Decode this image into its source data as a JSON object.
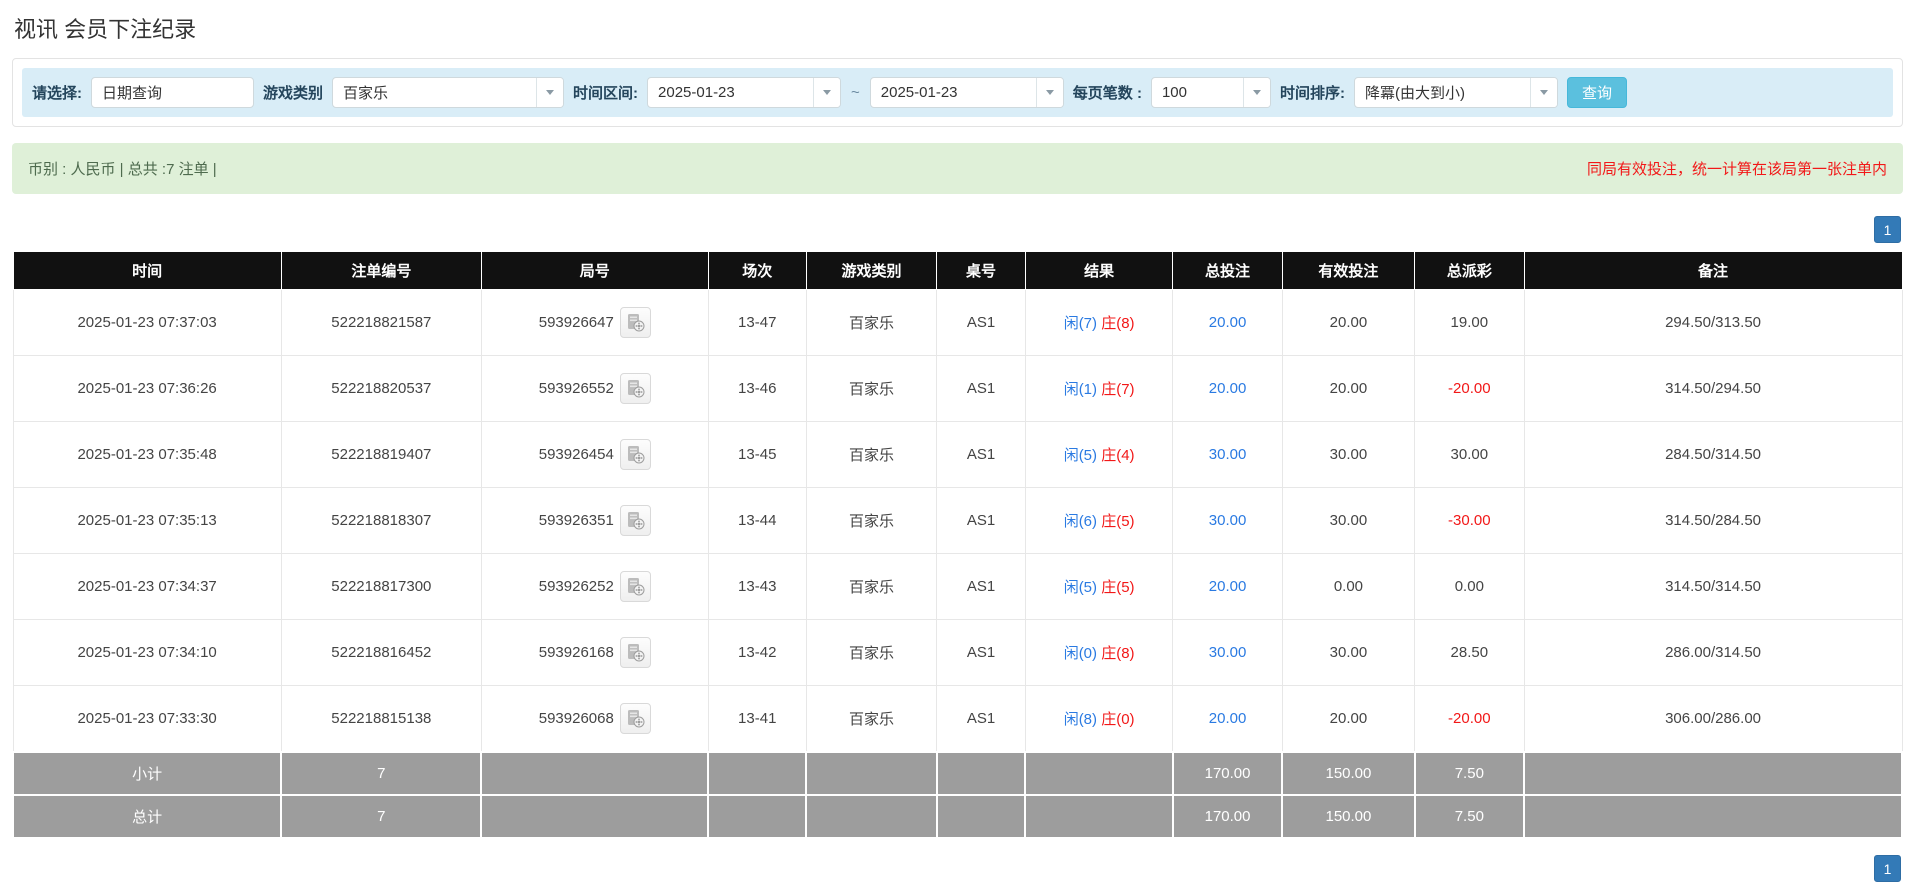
{
  "page": {
    "title": "视讯 会员下注纪录"
  },
  "filters": {
    "select_label": "请选择:",
    "select_value": "日期查询",
    "game_label": "游戏类别",
    "game_value": "百家乐",
    "range_label": "时间区间:",
    "date_from": "2025-01-23",
    "tilde": "~",
    "date_to": "2025-01-23",
    "page_size_label": "每页笔数 :",
    "page_size_value": "100",
    "sort_label": "时间排序:",
    "sort_value": "降冪(由大到小)",
    "search_button": "查询"
  },
  "notice": {
    "left": "币别 : 人民币 | 总共 :7 注单 |",
    "right": "同局有效投注，统一计算在该局第一张注单内"
  },
  "pagination": {
    "page": "1"
  },
  "table": {
    "headers": [
      "时间",
      "注单编号",
      "局号",
      "场次",
      "游戏类别",
      "桌号",
      "结果",
      "总投注",
      "有效投注",
      "总派彩",
      "备注"
    ],
    "rows": [
      {
        "time": "2025-01-23 07:37:03",
        "bet_id": "522218821587",
        "round_id": "593926647",
        "session": "13-47",
        "game": "百家乐",
        "table_no": "AS1",
        "result_player": "闲(7)",
        "result_banker": "庄(8)",
        "total_bet": "20.00",
        "valid_bet": "20.00",
        "payout": "19.00",
        "note": "294.50/313.50"
      },
      {
        "time": "2025-01-23 07:36:26",
        "bet_id": "522218820537",
        "round_id": "593926552",
        "session": "13-46",
        "game": "百家乐",
        "table_no": "AS1",
        "result_player": "闲(1)",
        "result_banker": "庄(7)",
        "total_bet": "20.00",
        "valid_bet": "20.00",
        "payout": "-20.00",
        "note": "314.50/294.50"
      },
      {
        "time": "2025-01-23 07:35:48",
        "bet_id": "522218819407",
        "round_id": "593926454",
        "session": "13-45",
        "game": "百家乐",
        "table_no": "AS1",
        "result_player": "闲(5)",
        "result_banker": "庄(4)",
        "total_bet": "30.00",
        "valid_bet": "30.00",
        "payout": "30.00",
        "note": "284.50/314.50"
      },
      {
        "time": "2025-01-23 07:35:13",
        "bet_id": "522218818307",
        "round_id": "593926351",
        "session": "13-44",
        "game": "百家乐",
        "table_no": "AS1",
        "result_player": "闲(6)",
        "result_banker": "庄(5)",
        "total_bet": "30.00",
        "valid_bet": "30.00",
        "payout": "-30.00",
        "note": "314.50/284.50"
      },
      {
        "time": "2025-01-23 07:34:37",
        "bet_id": "522218817300",
        "round_id": "593926252",
        "session": "13-43",
        "game": "百家乐",
        "table_no": "AS1",
        "result_player": "闲(5)",
        "result_banker": "庄(5)",
        "total_bet": "20.00",
        "valid_bet": "0.00",
        "payout": "0.00",
        "note": "314.50/314.50"
      },
      {
        "time": "2025-01-23 07:34:10",
        "bet_id": "522218816452",
        "round_id": "593926168",
        "session": "13-42",
        "game": "百家乐",
        "table_no": "AS1",
        "result_player": "闲(0)",
        "result_banker": "庄(8)",
        "total_bet": "30.00",
        "valid_bet": "30.00",
        "payout": "28.50",
        "note": "286.00/314.50"
      },
      {
        "time": "2025-01-23 07:33:30",
        "bet_id": "522218815138",
        "round_id": "593926068",
        "session": "13-41",
        "game": "百家乐",
        "table_no": "AS1",
        "result_player": "闲(8)",
        "result_banker": "庄(0)",
        "total_bet": "20.00",
        "valid_bet": "20.00",
        "payout": "-20.00",
        "note": "306.00/286.00"
      }
    ],
    "subtotal": {
      "label": "小计",
      "count": "7",
      "total_bet": "170.00",
      "valid_bet": "150.00",
      "payout": "7.50"
    },
    "total": {
      "label": "总计",
      "count": "7",
      "total_bet": "170.00",
      "valid_bet": "150.00",
      "payout": "7.50"
    }
  },
  "icons": {
    "dropdown_arrow": "chevron-down-icon",
    "video_replay": "video-file-icon"
  },
  "colors": {
    "filter_bar_bg": "#d9edf7",
    "notice_bg": "#dff0d8",
    "notice_warning_red": "#f21818",
    "table_header_bg": "#111111",
    "summary_row_bg": "#9d9d9d",
    "link_blue": "#2a7ae2",
    "result_player_blue": "#2a7ae2",
    "result_banker_red": "#f21818",
    "search_button_bg": "#5bc0de",
    "pagination_bg": "#337ab7"
  }
}
